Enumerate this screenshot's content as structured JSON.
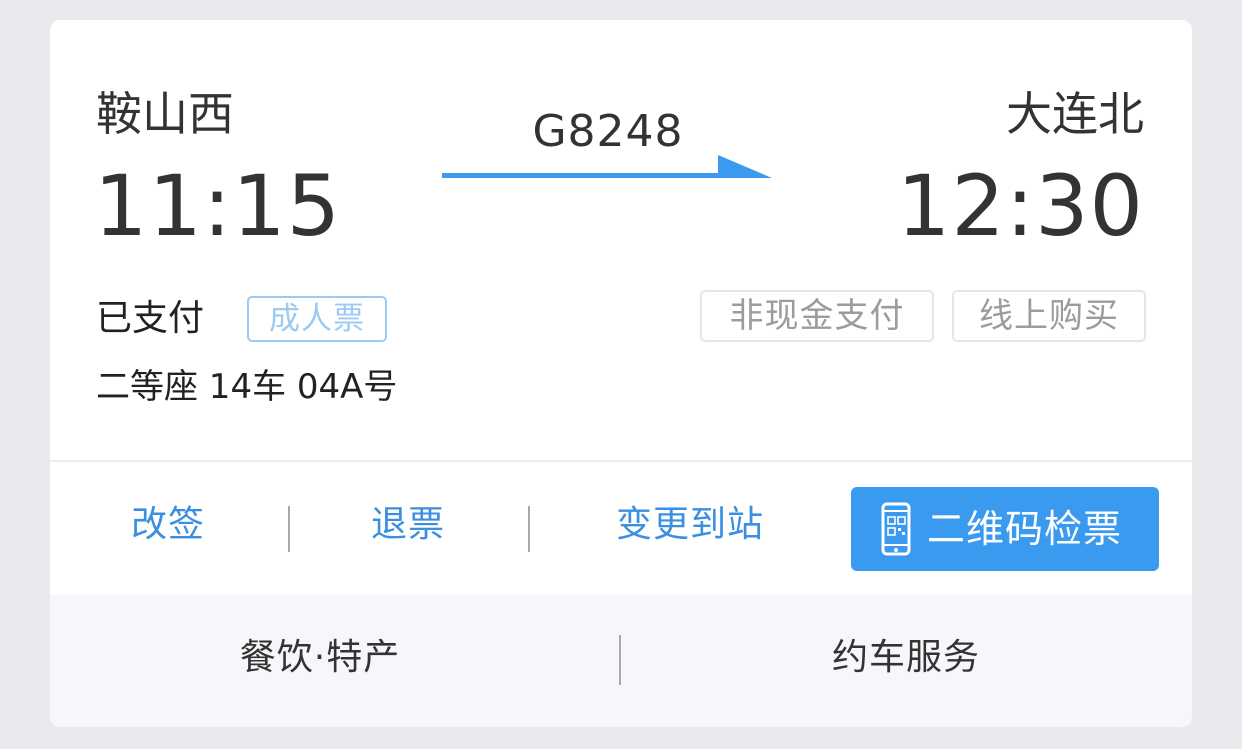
{
  "ticket": {
    "from_station": "鞍山西",
    "to_station": "大连北",
    "departure_time": "11:15",
    "arrival_time": "12:30",
    "train_number": "G8248",
    "payment_status": "已支付",
    "ticket_type": "成人票",
    "tags": [
      "非现金支付",
      "线上购买"
    ],
    "seat_info": "二等座 14车 04A号"
  },
  "actions": {
    "change": "改签",
    "refund": "退票",
    "change_destination": "变更到站",
    "qr_check": "二维码检票"
  },
  "bottom_links": {
    "food": "餐饮·特产",
    "car": "约车服务"
  },
  "colors": {
    "accent": "#3a9af0",
    "link": "#3b8fe0",
    "badge": "#9ccaf3",
    "arrow": "#3a9af0"
  },
  "icons": {
    "route": "right-arrow-icon",
    "qr": "phone-qr-icon"
  }
}
